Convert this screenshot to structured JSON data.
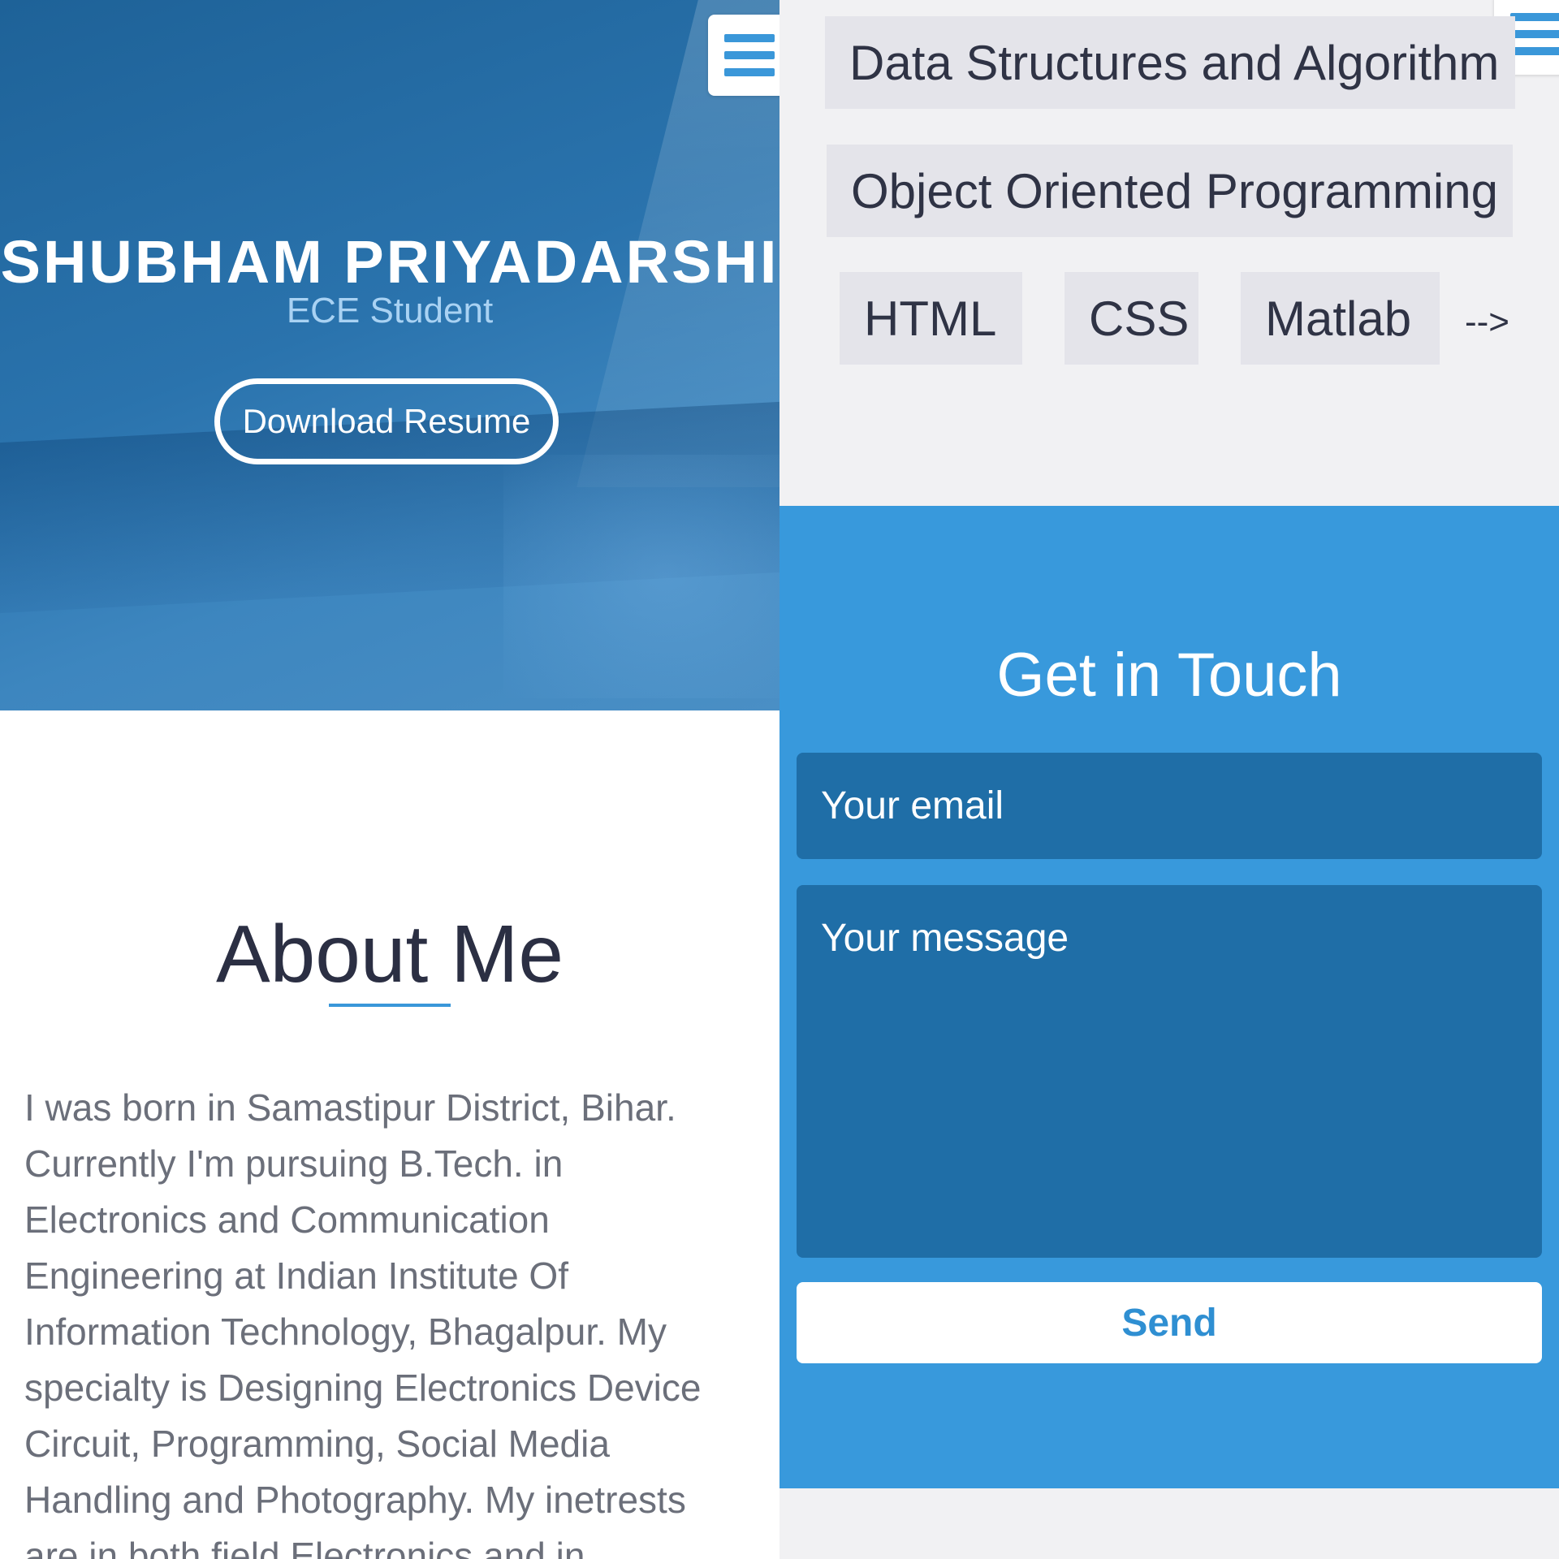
{
  "hero": {
    "name": "SHUBHAM PRIYADARSHI",
    "role": "ECE Student",
    "resume_button": "Download Resume"
  },
  "menu_icon": "hamburger-menu-icon",
  "about": {
    "title": "About Me",
    "text": "I was born in Samastipur District, Bihar. Currently I'm pursuing B.Tech. in Electronics and Communication Engineering at Indian Institute Of Information Technology, Bhagalpur. My specialty is Designing Electronics Device Circuit, Programming, Social Media Handling and Photography. My inetrests are in both field Electronics and in"
  },
  "skills": {
    "items": [
      "Data Structures and Algorithm",
      "Object Oriented Programming",
      "HTML",
      "CSS",
      "Matlab"
    ],
    "more": "-->"
  },
  "contact": {
    "title": "Get in Touch",
    "email_placeholder": "Your email",
    "message_placeholder": "Your message",
    "send_button": "Send"
  },
  "colors": {
    "accent": "#3899dc",
    "field": "#1f6ea7",
    "hero": "#1e6298"
  }
}
